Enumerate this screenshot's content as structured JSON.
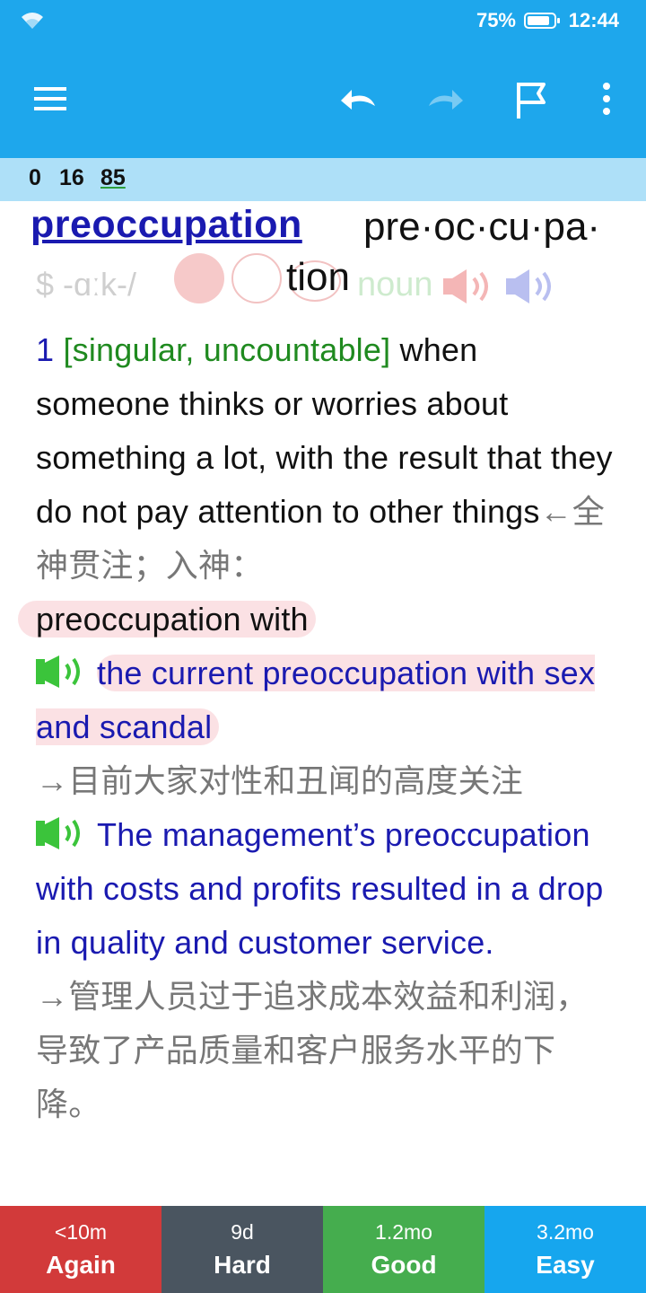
{
  "status": {
    "battery": "75%",
    "time": "12:44"
  },
  "toolbar": {
    "menu_icon": "hamburger-menu-icon",
    "undo_icon": "undo-icon",
    "redo_icon": "redo-icon",
    "flag_icon": "flag-icon",
    "more_icon": "more-vertical-icon"
  },
  "counts": {
    "new": "0",
    "learning": "16",
    "review": "85"
  },
  "entry": {
    "headword": "preoccupation",
    "syllables_line1": "pre·oc·cu·pa·",
    "syllables_line2": "tion",
    "pron_fragment": "$ -ɑːk-/",
    "pos_fragment": "noun",
    "sense_number": "1",
    "grammar": "[singular, uncountable]",
    "definition": "when someone thinks or worries about something a lot, with the result that they do not pay attention to other things",
    "translation": "←全神贯注；入神：",
    "collocation": "preoccupation with",
    "examples": [
      {
        "text": "the current preoccupation with sex and scandal",
        "translation": "→目前大家对性和丑闻的高度关注"
      },
      {
        "text": "The management’s preoccupation with costs and profits resulted in a drop in quality and customer service.",
        "translation": "→管理人员过于追求成本效益和利润，导致了产品质量和客户服务水平的下降。"
      }
    ]
  },
  "answers": [
    {
      "time": "<10m",
      "label": "Again",
      "color": "#d23a3a"
    },
    {
      "time": "9d",
      "label": "Hard",
      "color": "#4a5560"
    },
    {
      "time": "1.2mo",
      "label": "Good",
      "color": "#45ad4e"
    },
    {
      "time": "3.2mo",
      "label": "Easy",
      "color": "#16a6ee"
    }
  ],
  "colors": {
    "toolbar": "#1ea7ec",
    "counts_bar": "#aee0f8",
    "headword": "#1a1ab0",
    "grammar": "#1f8a1f"
  }
}
